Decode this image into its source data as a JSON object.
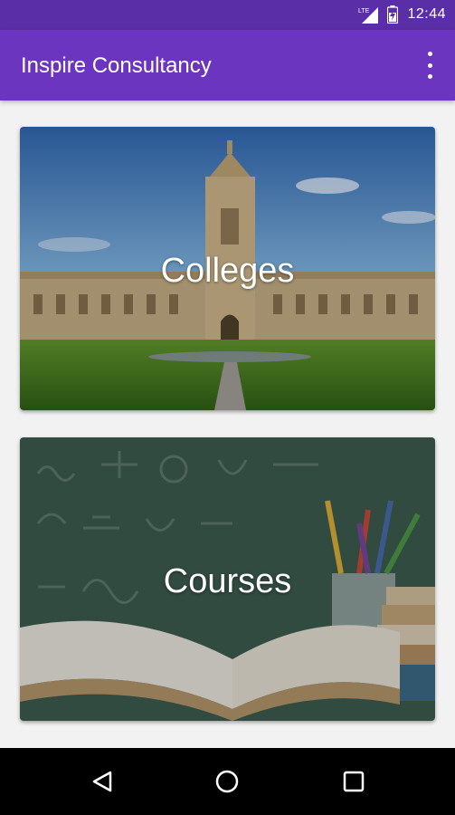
{
  "status_bar": {
    "network_label": "LTE",
    "time": "12:44"
  },
  "app_bar": {
    "title": "Inspire Consultancy",
    "overflow_icon": "more-vert-icon"
  },
  "cards": [
    {
      "label": "Colleges",
      "image": "college-building-photo"
    },
    {
      "label": "Courses",
      "image": "books-chalkboard-photo"
    }
  ],
  "nav_bar": {
    "back_icon": "back-icon",
    "home_icon": "home-icon",
    "recents_icon": "recents-icon"
  },
  "colors": {
    "status_bar": "#5a2ea6",
    "app_bar": "#6c35c0",
    "background": "#f2f2f2"
  }
}
